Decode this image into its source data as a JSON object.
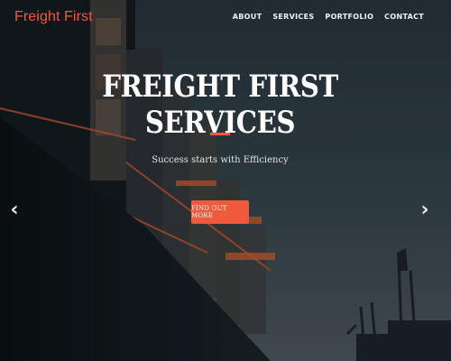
{
  "navbar": {
    "brand": "Freight First",
    "links": [
      "ABOUT",
      "SERVICES",
      "PORTFOLIO",
      "CONTACT"
    ]
  },
  "hero": {
    "title": "FREIGHT FIRST SERVICES",
    "subtitle": "Success starts with Efficiency",
    "cta_label": "FIND OUT MORE",
    "prev_icon": "chevron-left-icon",
    "next_icon": "chevron-right-icon",
    "accent_color": "#f05a3c"
  }
}
